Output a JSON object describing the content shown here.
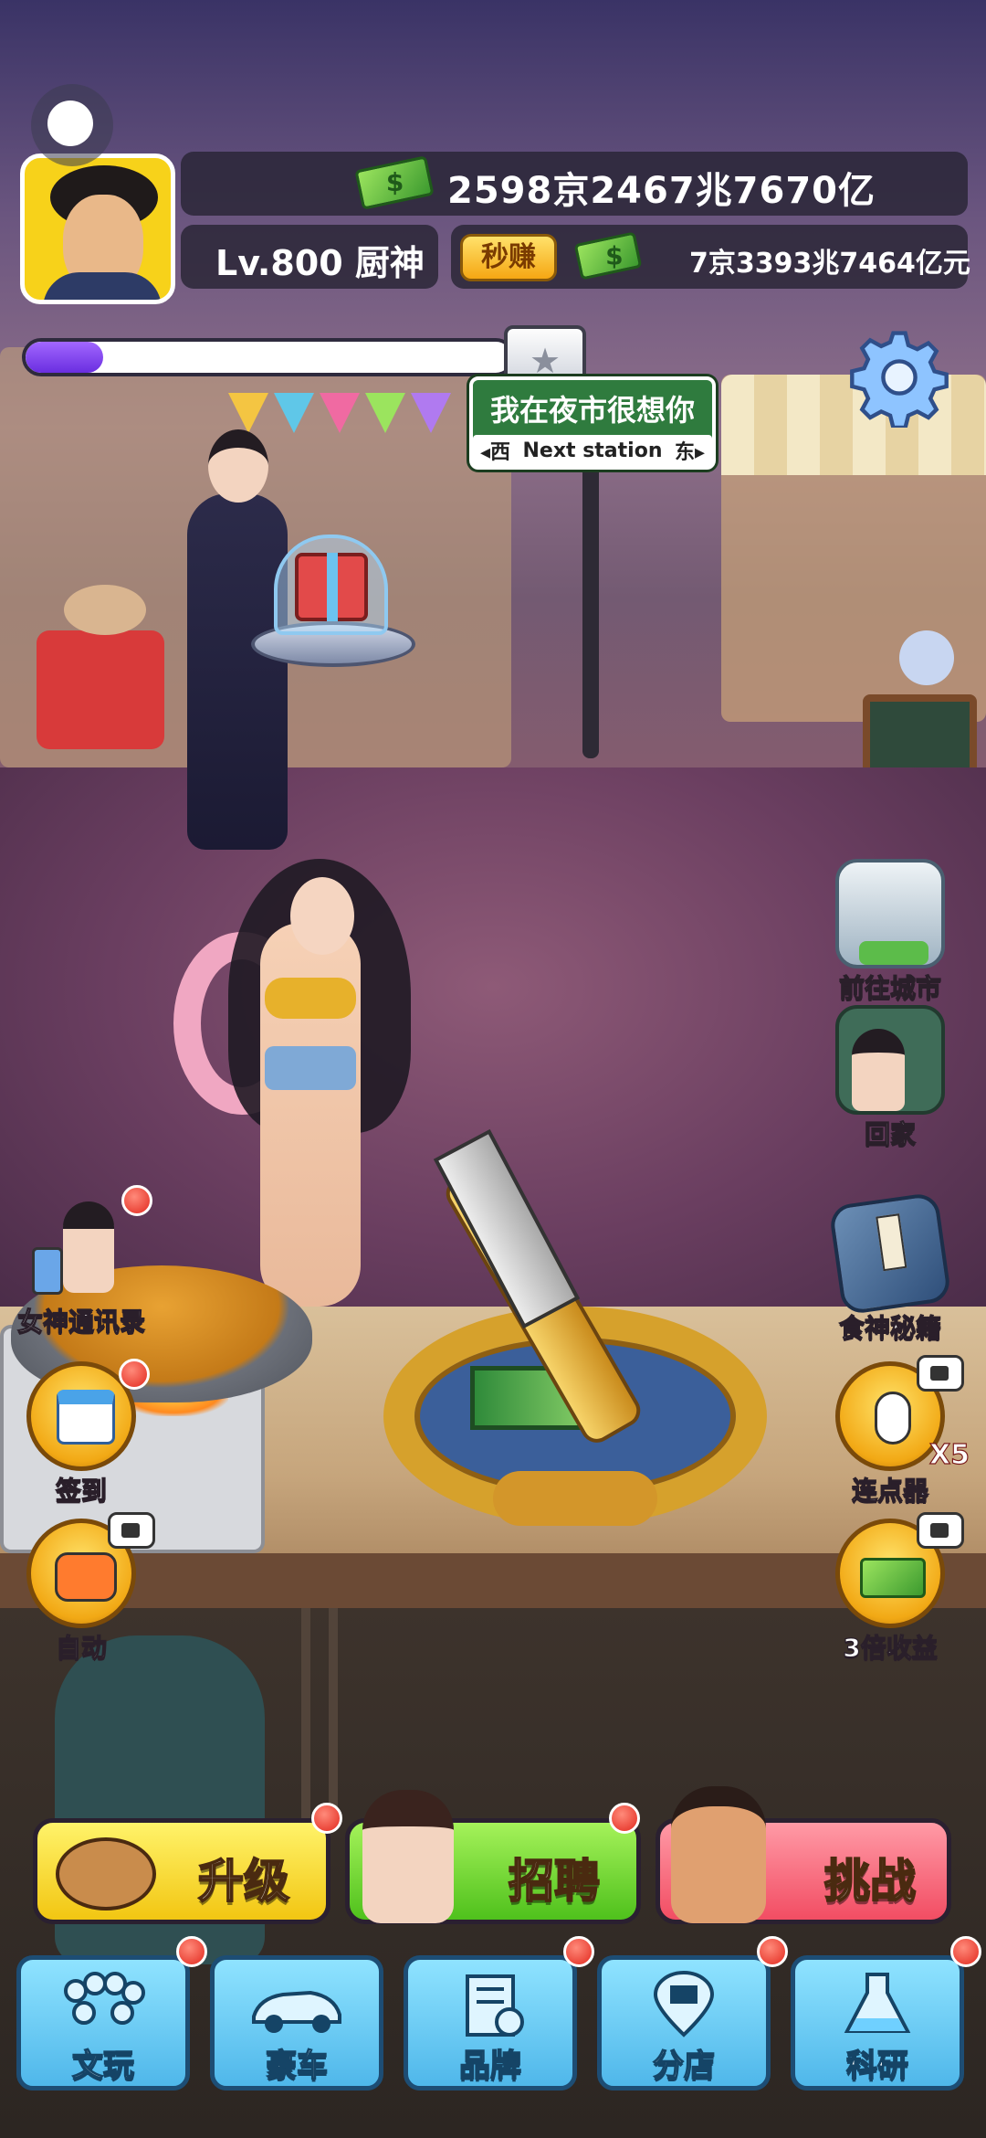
{
  "hud": {
    "avatar_icon": "chef-avatar-icon",
    "money": "2598京2467兆7670亿",
    "level": "Lv.800 厨神",
    "instant_label": "秒赚",
    "income": "7京3393兆7464亿元",
    "progress_fraction": 0.16,
    "progress_box_icon": "star-box-icon",
    "settings_icon": "gear-icon",
    "cash_icon": "cash-stack-icon"
  },
  "station": {
    "name": "我在夜市很想你",
    "west": "西",
    "next": "Next station",
    "east": "东"
  },
  "side_right": [
    {
      "label": "前往城市",
      "icon": "city-buildings-icon"
    },
    {
      "label": "回家",
      "icon": "home-door-icon"
    },
    {
      "label": "食神秘籍",
      "icon": "recipe-book-icon"
    },
    {
      "label": "连点器",
      "icon": "tap-hand-icon",
      "multiplier": "X5"
    },
    {
      "label": "3倍收益",
      "icon": "money-triple-icon"
    }
  ],
  "side_left": [
    {
      "label": "女神通讯录",
      "icon": "goddess-contacts-icon"
    },
    {
      "label": "签到",
      "icon": "calendar-checkin-icon"
    },
    {
      "label": "自动",
      "icon": "robot-auto-icon"
    }
  ],
  "actions": [
    {
      "label": "升级",
      "icon": "cleaver-board-icon",
      "color": "#f7e23a"
    },
    {
      "label": "招聘",
      "icon": "woman-portrait-icon",
      "color": "#7fe040"
    },
    {
      "label": "挑战",
      "icon": "rival-chef-icon",
      "color": "#ff7a86"
    }
  ],
  "nav": [
    {
      "label": "文玩",
      "icon": "bead-bracelet-icon"
    },
    {
      "label": "豪车",
      "icon": "sports-car-icon"
    },
    {
      "label": "品牌",
      "icon": "brand-building-icon"
    },
    {
      "label": "分店",
      "icon": "store-location-icon"
    },
    {
      "label": "科研",
      "icon": "flask-icon"
    }
  ],
  "colors": {
    "progress": "#8a4cf5",
    "hud_panel": "#28243a",
    "badge": "#e2291e",
    "nav_tile": "#5fc2ef"
  }
}
